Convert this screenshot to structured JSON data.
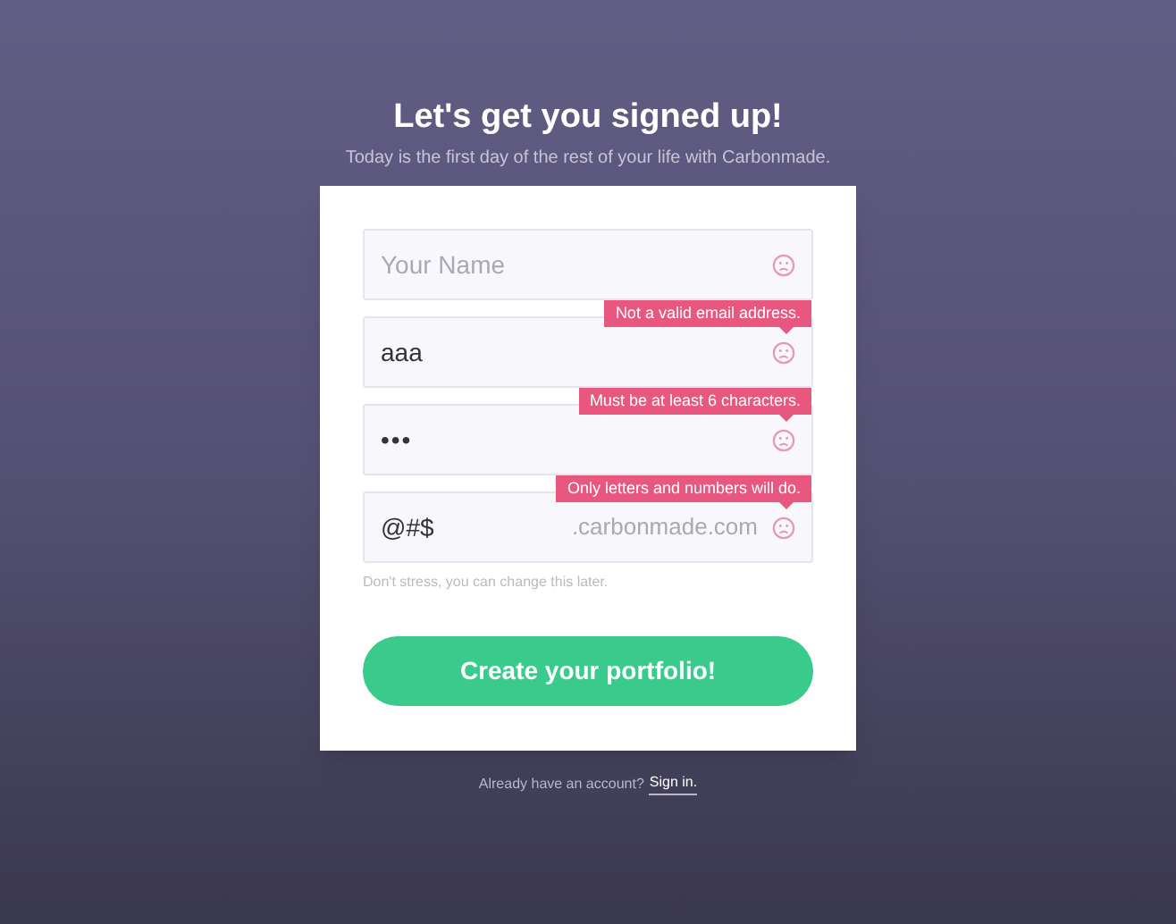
{
  "header": {
    "title": "Let's get you signed up!",
    "subtitle": "Today is the first day of the rest of your life with Carbonmade."
  },
  "fields": [
    {
      "kind": "text",
      "placeholder": "Your Name"
    },
    {
      "kind": "text",
      "value": "aaa",
      "error": "Not a valid email address."
    },
    {
      "kind": "password",
      "value": "•••",
      "error": "Must be at least 6 characters."
    },
    {
      "kind": "subdomain",
      "value": "@#$",
      "suffix": ".carbonmade.com",
      "error": "Only letters and numbers will do.",
      "hint": "Don't stress, you can change this later."
    }
  ],
  "submit": "Create your portfolio!",
  "footer": {
    "text": "Already have an account?",
    "link": "Sign in."
  }
}
